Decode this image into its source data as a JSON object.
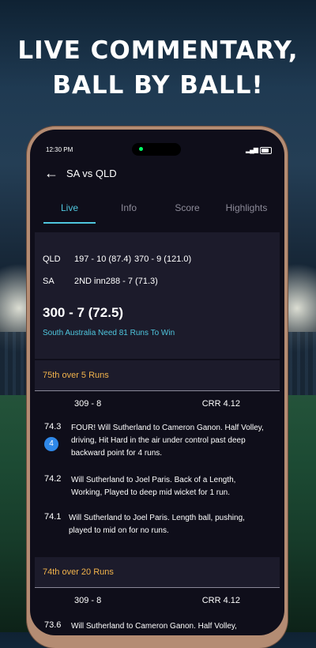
{
  "promo": {
    "line1": "LIVE COMMENTARY,",
    "line2": "BALL BY BALL!"
  },
  "status_bar": {
    "time": "12:30 PM"
  },
  "header": {
    "title": "SA vs QLD"
  },
  "tabs": [
    {
      "label": "Live",
      "active": true
    },
    {
      "label": "Info",
      "active": false
    },
    {
      "label": "Score",
      "active": false
    },
    {
      "label": "Highlights",
      "active": false
    }
  ],
  "summary": {
    "rows": [
      {
        "team": "QLD",
        "inn1": "197 - 10 (87.4)",
        "inn2": "370 - 9 (121.0)"
      },
      {
        "team": "SA",
        "inn1": "2ND inn288 - 7 (71.3)",
        "inn2": ""
      }
    ],
    "current_score": "300 - 7 (72.5)",
    "need_text": "South Australia Need 81 Runs To Win"
  },
  "overs": [
    {
      "header": "75th over 5 Runs",
      "score": "309 - 8",
      "crr": "CRR 4.12",
      "balls": [
        {
          "num": "74.3",
          "badge": "4",
          "text": "FOUR! Will Sutherland to Cameron Ganon. Half Volley, driving, Hit Hard in the air under control past deep backward point for 4 runs."
        },
        {
          "num": "74.2",
          "badge": "",
          "text": "Will Sutherland to Joel Paris. Back of a Length, Working, Played to deep mid wicket for 1 run."
        },
        {
          "num": "74.1",
          "badge": "",
          "text": "Will Sutherland to Joel Paris. Length ball, pushing, played to mid on for no runs."
        }
      ]
    },
    {
      "header": "74th over 20 Runs",
      "score": "309 - 8",
      "crr": "CRR 4.12",
      "balls": [
        {
          "num": "73.6",
          "badge": "",
          "text": "Will Sutherland to Cameron Ganon. Half Volley,"
        }
      ]
    }
  ],
  "colors": {
    "accent": "#4fc6de",
    "over_header": "#f2b34b",
    "badge": "#2f88e8",
    "card": "#1c1b2b",
    "screen": "#0f0e1a"
  }
}
